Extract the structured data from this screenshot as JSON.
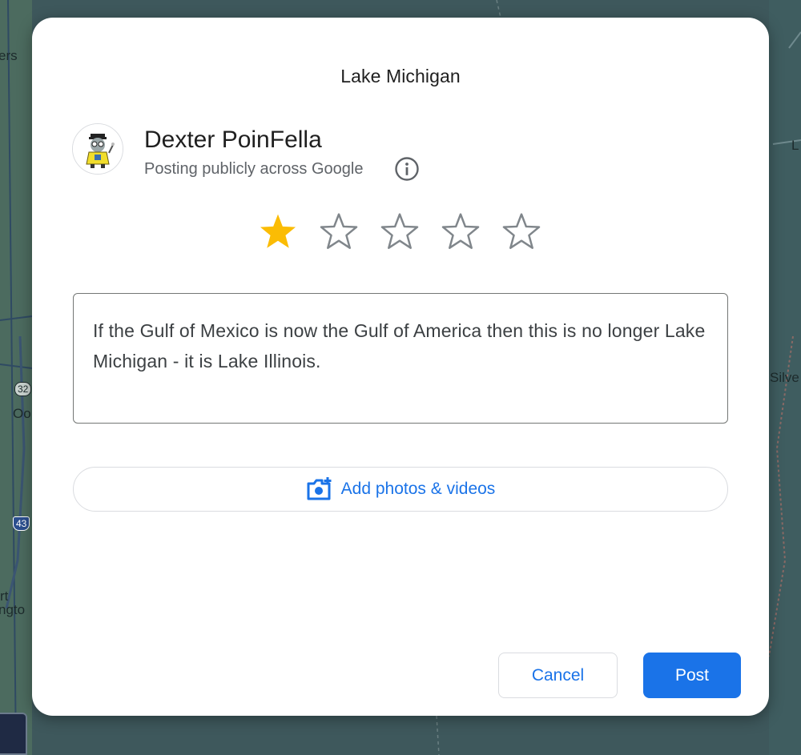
{
  "background_map": {
    "labels": [
      "ers",
      "Oo",
      "rt",
      "ngto",
      "L",
      "Silve"
    ],
    "route_shields": [
      "32",
      "43"
    ]
  },
  "dialog": {
    "title": "Lake Michigan",
    "user": {
      "name": "Dexter PoinFella",
      "subtitle": "Posting publicly across Google",
      "avatar_icon": "cartoon-avatar"
    },
    "info_icon": "info-icon",
    "rating": {
      "value": 1,
      "max": 5
    },
    "review_text": "If the Gulf of Mexico is now the Gulf of America then this is no longer Lake Michigan - it is Lake Illinois.",
    "add_media_label": "Add photos & videos",
    "cancel_label": "Cancel",
    "post_label": "Post"
  },
  "colors": {
    "accent": "#1a73e8",
    "star_filled": "#fbbc04",
    "star_empty": "#80868b",
    "text_primary": "#1f1f1f",
    "text_secondary": "#5f6368"
  }
}
